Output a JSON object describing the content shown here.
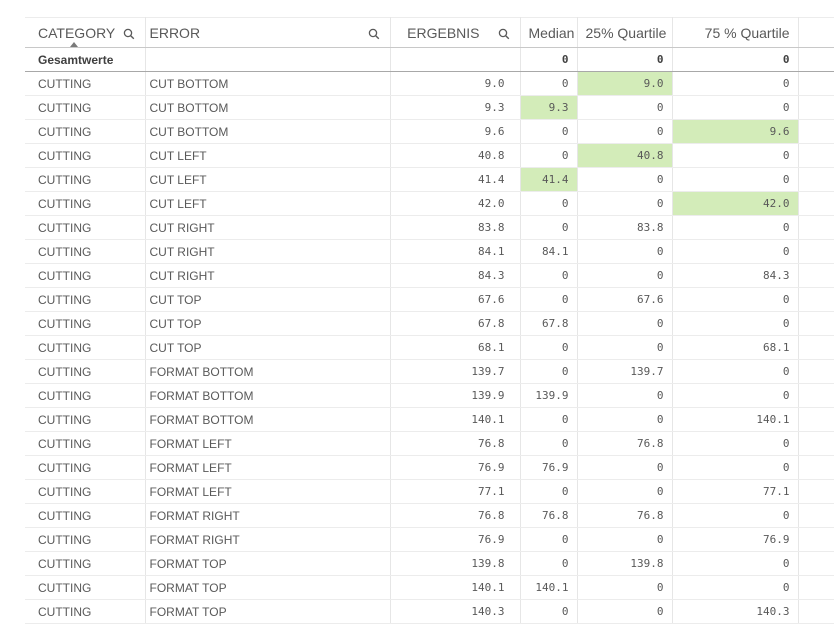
{
  "table": {
    "headers": {
      "category": "CATEGORY",
      "error": "ERROR",
      "ergebnis": "ERGEBNIS",
      "median": "Median",
      "q25": "25% Quartile",
      "q75": "75 % Quartile"
    },
    "icons": {
      "search": "search-icon",
      "sort": "sort-ascending-icon"
    },
    "totals": {
      "label": "Gesamtwerte",
      "median": "0",
      "q25": "0",
      "q75": "0"
    },
    "highlight_color": "#d3ecb9",
    "rows": [
      {
        "category": "CUTTING",
        "error": "CUT BOTTOM",
        "ergebnis": "9.0",
        "median": "0",
        "q25": "9.0",
        "q75": "0",
        "hl": "q25"
      },
      {
        "category": "CUTTING",
        "error": "CUT BOTTOM",
        "ergebnis": "9.3",
        "median": "9.3",
        "q25": "0",
        "q75": "0",
        "hl": "median"
      },
      {
        "category": "CUTTING",
        "error": "CUT BOTTOM",
        "ergebnis": "9.6",
        "median": "0",
        "q25": "0",
        "q75": "9.6",
        "hl": "q75"
      },
      {
        "category": "CUTTING",
        "error": "CUT LEFT",
        "ergebnis": "40.8",
        "median": "0",
        "q25": "40.8",
        "q75": "0",
        "hl": "q25"
      },
      {
        "category": "CUTTING",
        "error": "CUT LEFT",
        "ergebnis": "41.4",
        "median": "41.4",
        "q25": "0",
        "q75": "0",
        "hl": "median"
      },
      {
        "category": "CUTTING",
        "error": "CUT LEFT",
        "ergebnis": "42.0",
        "median": "0",
        "q25": "0",
        "q75": "42.0",
        "hl": "q75"
      },
      {
        "category": "CUTTING",
        "error": "CUT RIGHT",
        "ergebnis": "83.8",
        "median": "0",
        "q25": "83.8",
        "q75": "0",
        "hl": ""
      },
      {
        "category": "CUTTING",
        "error": "CUT RIGHT",
        "ergebnis": "84.1",
        "median": "84.1",
        "q25": "0",
        "q75": "0",
        "hl": ""
      },
      {
        "category": "CUTTING",
        "error": "CUT RIGHT",
        "ergebnis": "84.3",
        "median": "0",
        "q25": "0",
        "q75": "84.3",
        "hl": ""
      },
      {
        "category": "CUTTING",
        "error": "CUT TOP",
        "ergebnis": "67.6",
        "median": "0",
        "q25": "67.6",
        "q75": "0",
        "hl": ""
      },
      {
        "category": "CUTTING",
        "error": "CUT TOP",
        "ergebnis": "67.8",
        "median": "67.8",
        "q25": "0",
        "q75": "0",
        "hl": ""
      },
      {
        "category": "CUTTING",
        "error": "CUT TOP",
        "ergebnis": "68.1",
        "median": "0",
        "q25": "0",
        "q75": "68.1",
        "hl": ""
      },
      {
        "category": "CUTTING",
        "error": "FORMAT BOTTOM",
        "ergebnis": "139.7",
        "median": "0",
        "q25": "139.7",
        "q75": "0",
        "hl": ""
      },
      {
        "category": "CUTTING",
        "error": "FORMAT BOTTOM",
        "ergebnis": "139.9",
        "median": "139.9",
        "q25": "0",
        "q75": "0",
        "hl": ""
      },
      {
        "category": "CUTTING",
        "error": "FORMAT BOTTOM",
        "ergebnis": "140.1",
        "median": "0",
        "q25": "0",
        "q75": "140.1",
        "hl": ""
      },
      {
        "category": "CUTTING",
        "error": "FORMAT LEFT",
        "ergebnis": "76.8",
        "median": "0",
        "q25": "76.8",
        "q75": "0",
        "hl": ""
      },
      {
        "category": "CUTTING",
        "error": "FORMAT LEFT",
        "ergebnis": "76.9",
        "median": "76.9",
        "q25": "0",
        "q75": "0",
        "hl": ""
      },
      {
        "category": "CUTTING",
        "error": "FORMAT LEFT",
        "ergebnis": "77.1",
        "median": "0",
        "q25": "0",
        "q75": "77.1",
        "hl": ""
      },
      {
        "category": "CUTTING",
        "error": "FORMAT RIGHT",
        "ergebnis": "76.8",
        "median": "76.8",
        "q25": "76.8",
        "q75": "0",
        "hl": ""
      },
      {
        "category": "CUTTING",
        "error": "FORMAT RIGHT",
        "ergebnis": "76.9",
        "median": "0",
        "q25": "0",
        "q75": "76.9",
        "hl": ""
      },
      {
        "category": "CUTTING",
        "error": "FORMAT TOP",
        "ergebnis": "139.8",
        "median": "0",
        "q25": "139.8",
        "q75": "0",
        "hl": ""
      },
      {
        "category": "CUTTING",
        "error": "FORMAT TOP",
        "ergebnis": "140.1",
        "median": "140.1",
        "q25": "0",
        "q75": "0",
        "hl": ""
      },
      {
        "category": "CUTTING",
        "error": "FORMAT TOP",
        "ergebnis": "140.3",
        "median": "0",
        "q25": "0",
        "q75": "140.3",
        "hl": ""
      }
    ]
  }
}
